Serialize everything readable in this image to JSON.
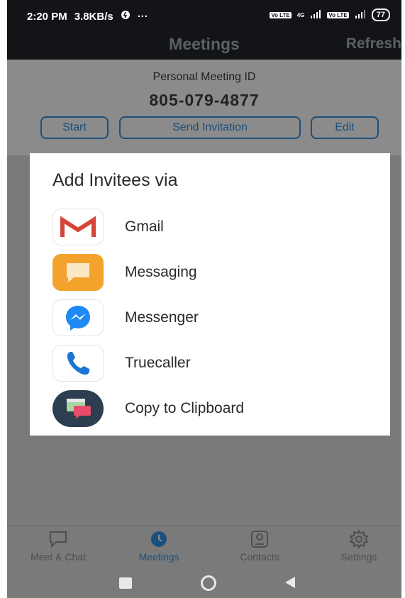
{
  "status_bar": {
    "time": "2:20 PM",
    "speed": "3.8KB/s",
    "dots": "···",
    "sim1": "Vo LTE",
    "net": "4G",
    "sim2": "Vo LTE",
    "battery": "77"
  },
  "app_bar": {
    "title": "Meetings",
    "refresh_label": "Refresh"
  },
  "meeting": {
    "pmi_label": "Personal Meeting ID",
    "pmi_number": "805-079-4877",
    "start_label": "Start",
    "send_invitation_label": "Send Invitation",
    "edit_label": "Edit"
  },
  "dialog": {
    "title": "Add Invitees via",
    "options": [
      {
        "label": "Gmail",
        "icon": "gmail-icon"
      },
      {
        "label": "Messaging",
        "icon": "messaging-icon"
      },
      {
        "label": "Messenger",
        "icon": "messenger-icon"
      },
      {
        "label": "Truecaller",
        "icon": "truecaller-icon"
      },
      {
        "label": "Copy to Clipboard",
        "icon": "clipboard-icon"
      }
    ]
  },
  "bottom_nav": {
    "items": [
      {
        "label": "Meet & Chat",
        "icon": "chat-bubble-icon",
        "active": false
      },
      {
        "label": "Meetings",
        "icon": "clock-icon",
        "active": true
      },
      {
        "label": "Contacts",
        "icon": "contact-card-icon",
        "active": false
      },
      {
        "label": "Settings",
        "icon": "gear-icon",
        "active": false
      }
    ]
  },
  "colors": {
    "accent": "#1c4f7c",
    "overlay": "#7a7a7a",
    "dialog_bg": "#ffffff"
  }
}
